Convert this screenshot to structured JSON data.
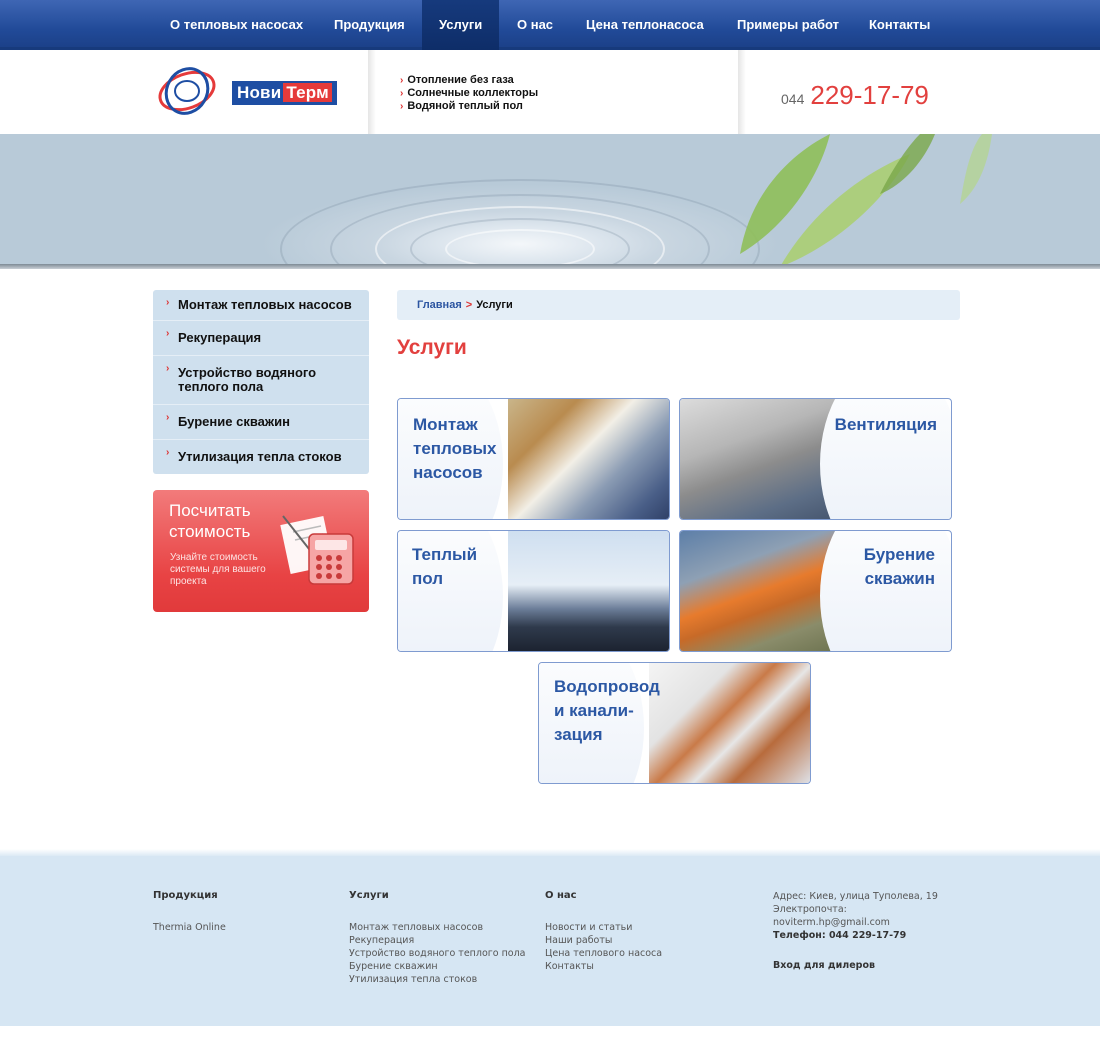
{
  "nav": {
    "items": [
      {
        "label": "О тепловых насосах"
      },
      {
        "label": "Продукция"
      },
      {
        "label": "Услуги"
      },
      {
        "label": "О нас"
      },
      {
        "label": "Цена теплонасоса"
      },
      {
        "label": "Примеры работ"
      },
      {
        "label": "Контакты"
      }
    ]
  },
  "header": {
    "logo": {
      "part1": "Нови",
      "part2": "Терм"
    },
    "links": [
      "Отопление без газа",
      "Солнечные коллекторы",
      "Водяной теплый пол"
    ],
    "phone": {
      "code": "044",
      "number": "229-17-79"
    }
  },
  "sidebar": {
    "items": [
      {
        "label": "Монтаж тепловых насосов"
      },
      {
        "label": "Рекуперация"
      },
      {
        "label": "Устройство водяного теплого пола"
      },
      {
        "label": "Бурение скважин"
      },
      {
        "label": "Утилизация тепла стоков"
      }
    ],
    "calc": {
      "title": "Посчитать стоимость",
      "subtitle": "Узнайте стоимость системы для вашего проекта"
    }
  },
  "breadcrumb": {
    "home": "Главная",
    "separator": ">",
    "current": "Услуги"
  },
  "page_title": "Услуги",
  "tiles": [
    {
      "lines": [
        "Монтаж",
        "тепловых",
        "насосов"
      ]
    },
    {
      "lines": [
        "Вентиляция"
      ]
    },
    {
      "lines": [
        "Теплый",
        "пол"
      ]
    },
    {
      "lines": [
        "Бурение",
        "скважин"
      ]
    },
    {
      "lines": [
        "Водопровод",
        "и канали-",
        "зация"
      ]
    }
  ],
  "footer": {
    "products": {
      "heading": "Продукция",
      "links": [
        "Thermia Online"
      ]
    },
    "services": {
      "heading": "Услуги",
      "links": [
        "Монтаж тепловых насосов",
        "Рекуперация",
        "Устройство водяного теплого пола",
        "Бурение скважин",
        "Утилизация тепла стоков"
      ]
    },
    "about": {
      "heading": "О нас",
      "links": [
        "Новости и статьи",
        "Наши работы",
        "Цена теплового насоса",
        "Контакты"
      ]
    },
    "contact": {
      "address": "Адрес: Киев, улица Туполева, 19",
      "email_label": "Электропочта:",
      "email": "noviterm.hp@gmail.com",
      "phone": "Телефон: 044 229-17-79",
      "dealer_login": "Вход для дилеров"
    }
  },
  "colors": {
    "nav": "#214a98",
    "accent_red": "#e2403e",
    "link_blue": "#2c58a4",
    "sidebar_bg": "#cfe0ee",
    "footer_bg": "#d6e6f3"
  }
}
